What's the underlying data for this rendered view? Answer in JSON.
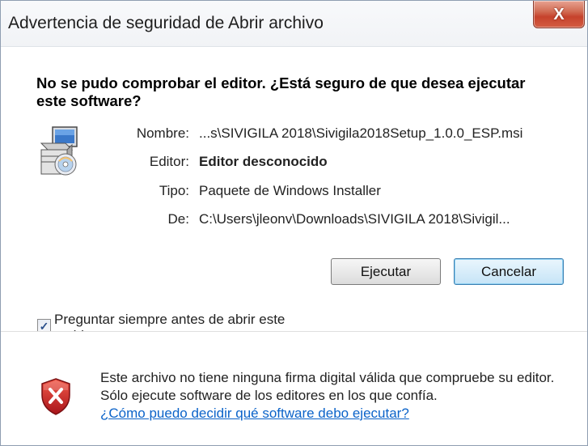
{
  "window": {
    "title": "Advertencia de seguridad de Abrir archivo",
    "close_glyph": "X"
  },
  "dialog": {
    "heading": "No se pudo comprobar el editor. ¿Está seguro de que desea ejecutar este software?",
    "fields": [
      {
        "label": "Nombre:",
        "value": "...s\\SIVIGILA 2018\\Sivigila2018Setup_1.0.0_ESP.msi",
        "bold": false
      },
      {
        "label": "Editor:",
        "value": "Editor desconocido",
        "bold": true
      },
      {
        "label": "Tipo:",
        "value": "Paquete de Windows Installer",
        "bold": false
      },
      {
        "label": "De:",
        "value": "C:\\Users\\jleonv\\Downloads\\SIVIGILA 2018\\Sivigil...",
        "bold": false
      }
    ],
    "buttons": {
      "run_label": "Ejecutar",
      "cancel_label": "Cancelar"
    },
    "checkbox": {
      "label": "Preguntar siempre antes de abrir este archivo",
      "checked": true,
      "mark": "✓"
    }
  },
  "footer": {
    "warning_text": "Este archivo no tiene ninguna firma digital válida que compruebe su editor. Sólo ejecute software de los editores en los que confía.",
    "help_link": "¿Cómo puedo decidir qué software debo ejecutar?"
  },
  "colors": {
    "link": "#0b63c9",
    "close_button": "#c6422c",
    "shield": "#c62828"
  },
  "icons": {
    "file": "installer-package-icon",
    "warning": "shield-error-icon",
    "close": "close-icon"
  }
}
